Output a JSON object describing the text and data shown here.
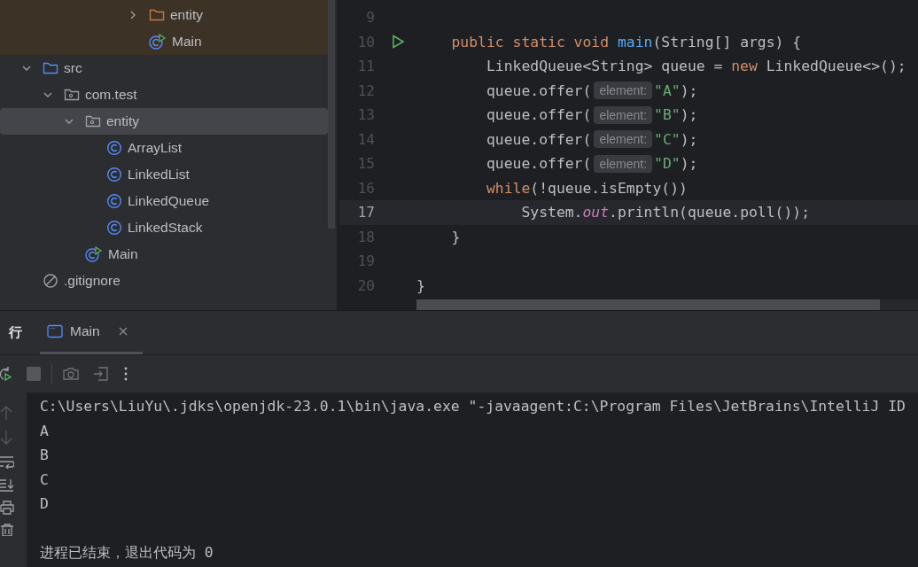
{
  "project_tree": {
    "upper_items": [
      {
        "label": "entity",
        "kind": "excluded-folder",
        "expanded": false,
        "selected": false
      },
      {
        "label": "Main",
        "kind": "main-class",
        "selected": false
      }
    ],
    "items": [
      {
        "label": "src",
        "kind": "source-folder",
        "expanded": true,
        "selected": false,
        "children": [
          {
            "label": "com.test",
            "kind": "package",
            "expanded": true,
            "selected": false,
            "children": [
              {
                "label": "entity",
                "kind": "package",
                "expanded": true,
                "selected": true,
                "children": [
                  {
                    "label": "ArrayList",
                    "kind": "class",
                    "selected": false
                  },
                  {
                    "label": "LinkedList",
                    "kind": "class",
                    "selected": false
                  },
                  {
                    "label": "LinkedQueue",
                    "kind": "class",
                    "selected": false
                  },
                  {
                    "label": "LinkedStack",
                    "kind": "class",
                    "selected": false
                  }
                ]
              },
              {
                "label": "Main",
                "kind": "main-class",
                "selected": false
              }
            ]
          }
        ]
      },
      {
        "label": ".gitignore",
        "kind": "ignore",
        "selected": false
      }
    ]
  },
  "editor": {
    "lines": [
      {
        "number": "9",
        "current": false,
        "run": false
      },
      {
        "number": "10",
        "current": false,
        "run": true,
        "tokens": [
          {
            "kind": "kw",
            "text": "    public static void "
          },
          {
            "kind": "fn",
            "text": "main"
          },
          {
            "kind": "plain",
            "text": "(String[] args) {"
          }
        ]
      },
      {
        "number": "11",
        "current": false,
        "run": false,
        "tokens": [
          {
            "kind": "plain",
            "text": "        LinkedQueue<String> queue = "
          },
          {
            "kind": "kw",
            "text": "new"
          },
          {
            "kind": "plain",
            "text": " LinkedQueue<>();"
          }
        ]
      },
      {
        "number": "12",
        "current": false,
        "run": false,
        "tokens": [
          {
            "kind": "plain",
            "text": "        queue.offer("
          },
          {
            "kind": "hint",
            "text": "element:"
          },
          {
            "kind": "str",
            "text": "\"A\""
          },
          {
            "kind": "plain",
            "text": ");"
          }
        ]
      },
      {
        "number": "13",
        "current": false,
        "run": false,
        "tokens": [
          {
            "kind": "plain",
            "text": "        queue.offer("
          },
          {
            "kind": "hint",
            "text": "element:"
          },
          {
            "kind": "str",
            "text": "\"B\""
          },
          {
            "kind": "plain",
            "text": ");"
          }
        ]
      },
      {
        "number": "14",
        "current": false,
        "run": false,
        "tokens": [
          {
            "kind": "plain",
            "text": "        queue.offer("
          },
          {
            "kind": "hint",
            "text": "element:"
          },
          {
            "kind": "str",
            "text": "\"C\""
          },
          {
            "kind": "plain",
            "text": ");"
          }
        ]
      },
      {
        "number": "15",
        "current": false,
        "run": false,
        "tokens": [
          {
            "kind": "plain",
            "text": "        queue.offer("
          },
          {
            "kind": "hint",
            "text": "element:"
          },
          {
            "kind": "str",
            "text": "\"D\""
          },
          {
            "kind": "plain",
            "text": ");"
          }
        ]
      },
      {
        "number": "16",
        "current": false,
        "run": false,
        "tokens": [
          {
            "kind": "kw",
            "text": "        while"
          },
          {
            "kind": "plain",
            "text": "(!queue.isEmpty())"
          }
        ]
      },
      {
        "number": "17",
        "current": true,
        "run": false,
        "tokens": [
          {
            "kind": "plain",
            "text": "            System."
          },
          {
            "kind": "field",
            "text": "out"
          },
          {
            "kind": "plain",
            "text": ".println(queue.poll());"
          }
        ]
      },
      {
        "number": "18",
        "current": false,
        "run": false,
        "tokens": [
          {
            "kind": "plain",
            "text": "    }"
          }
        ]
      },
      {
        "number": "19",
        "current": false,
        "run": false
      },
      {
        "number": "20",
        "current": false,
        "run": false,
        "tokens": [
          {
            "kind": "plain",
            "text": "}"
          }
        ]
      }
    ]
  },
  "run_panel": {
    "title": "行",
    "tabs": [
      {
        "label": "Main",
        "selected": true
      }
    ],
    "console": [
      {
        "text": "C:\\Users\\LiuYu\\.jdks\\openjdk-23.0.1\\bin\\java.exe \"-javaagent:C:\\Program Files\\JetBrains\\IntelliJ ID"
      },
      {
        "text": "A"
      },
      {
        "text": "B"
      },
      {
        "text": "C"
      },
      {
        "text": "D"
      }
    ],
    "exit_message": "进程已结束，退出代码为 0"
  }
}
